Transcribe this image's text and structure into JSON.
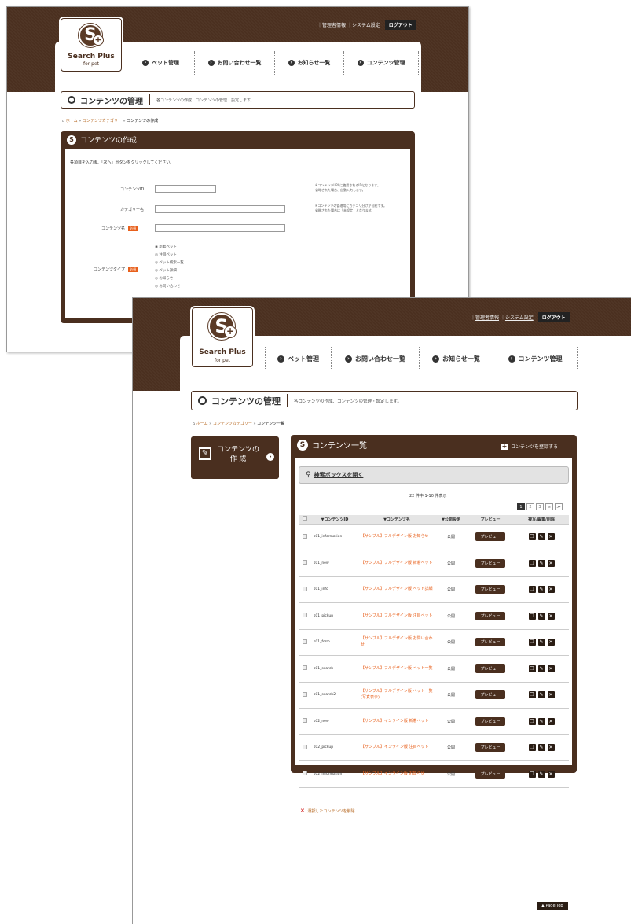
{
  "header": {
    "links": [
      "管理者情報",
      "システム設定"
    ],
    "logout": "ログアウト",
    "logo_main": "Search Plus",
    "logo_sub": "for pet",
    "logo_mark": "S",
    "nav": [
      "ペット管理",
      "お問い合わせ一覧",
      "お知らせ一覧",
      "コンテンツ管理"
    ]
  },
  "section": {
    "title": "コンテンツの管理",
    "description": "各コンテンツの作成、コンテンツの管理・設定します。"
  },
  "back_screen": {
    "breadcrumb": {
      "home": "ホーム",
      "sep": "»",
      "category": "コンテンツカテゴリー",
      "current": "コンテンツの作成"
    },
    "panel_title": "コンテンツの作成",
    "instruction": "各項目を入力後、「次へ」ボタンをクリックしてください。",
    "fields": {
      "content_id": "コンテンツID",
      "category_name": "カテゴリー名",
      "content_name": "コンテンツ名",
      "content_type": "コンテンツタイプ",
      "required": "必須"
    },
    "notes": {
      "content_id": [
        "※コンテンツURLに使用されるIDとなります。",
        "省略された場合、自動入力します。"
      ],
      "category_name": [
        "※コンテンツの管理用にカテゴリ分けが可能です。",
        "省略された場合は「未設定」となります。"
      ]
    },
    "content_types": [
      "新着ペット",
      "注目ペット",
      "ペット検索一覧",
      "ペット詳細",
      "お知らせ",
      "お問い合わせ"
    ]
  },
  "front_screen": {
    "breadcrumb": {
      "home": "ホーム",
      "sep": "»",
      "category": "コンテンツカテゴリー",
      "current": "コンテンツ一覧"
    },
    "create_button": {
      "line1": "コンテンツの",
      "line2": "作 成"
    },
    "panel_title": "コンテンツ一覧",
    "register_button": "コンテンツを登録する",
    "search_toggle": "検索ボックスを開く",
    "count_text": "22 件中 1-10 件表示",
    "pages": [
      "1",
      "2",
      "3",
      "≥",
      "≫"
    ],
    "columns": [
      "▼コンテンツID",
      "▼コンテンツ名",
      "▼公開設定",
      "プレビュー",
      "複写/編集/削除"
    ],
    "rows": [
      {
        "id": "s01_information",
        "name": "【サンプル】フルデザイン版 お知らせ",
        "status": "公開",
        "preview": "プレビュー"
      },
      {
        "id": "s01_new",
        "name": "【サンプル】フルデザイン版 新着ペット",
        "status": "公開",
        "preview": "プレビュー"
      },
      {
        "id": "s01_info",
        "name": "【サンプル】フルデザイン版 ペット詳細",
        "status": "公開",
        "preview": "プレビュー"
      },
      {
        "id": "s01_pickup",
        "name": "【サンプル】フルデザイン版 注目ペット",
        "status": "公開",
        "preview": "プレビュー"
      },
      {
        "id": "s01_form",
        "name": "【サンプル】フルデザイン版 お問い合わせ",
        "status": "公開",
        "preview": "プレビュー"
      },
      {
        "id": "s01_search",
        "name": "【サンプル】フルデザイン版 ペット一覧",
        "status": "公開",
        "preview": "プレビュー"
      },
      {
        "id": "s01_search2",
        "name": "【サンプル】フルデザイン版 ペット一覧(写真表示)",
        "status": "公開",
        "preview": "プレビュー"
      },
      {
        "id": "s02_new",
        "name": "【サンプル】インライン版 新着ペット",
        "status": "公開",
        "preview": "プレビュー"
      },
      {
        "id": "s02_pickup",
        "name": "【サンプル】インライン版 注目ペット",
        "status": "公開",
        "preview": "プレビュー"
      },
      {
        "id": "s02_information",
        "name": "【サンプル】インライン版 お知らせ",
        "status": "公開",
        "preview": "プレビュー"
      }
    ],
    "delete_selected": "選択したコンテンツを削除",
    "page_top": "Page Top"
  }
}
